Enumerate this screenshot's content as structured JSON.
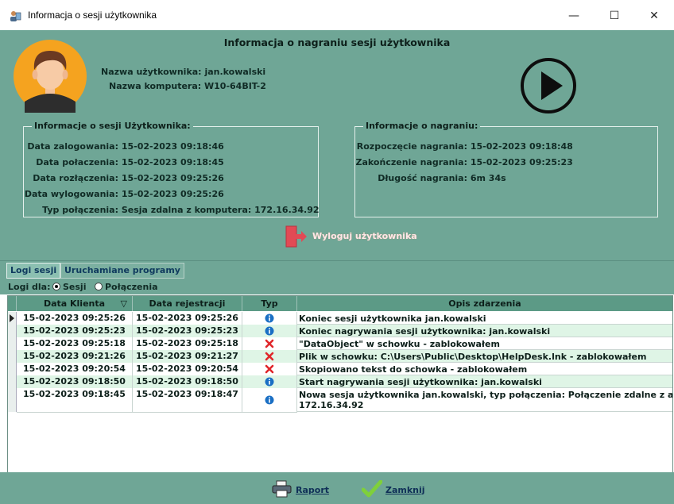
{
  "window": {
    "title": "Informacja o sesji użytkownika",
    "minimize_icon": "—",
    "maximize_icon": "☐",
    "close_icon": "✕"
  },
  "header": {
    "title": "Informacja o nagraniu sesji użytkownika"
  },
  "user": {
    "name_label": "Nazwa użytkownika:",
    "name_value": "jan.kowalski",
    "computer_label": "Nazwa komputera:",
    "computer_value": "W10-64BIT-2"
  },
  "session_info": {
    "legend": "Informacje o sesji Użytkownika:",
    "rows": [
      {
        "label": "Data zalogowania:",
        "value": "15-02-2023 09:18:46"
      },
      {
        "label": "Data połaczenia:",
        "value": "15-02-2023 09:18:45"
      },
      {
        "label": "Data rozłączenia:",
        "value": "15-02-2023 09:25:26"
      },
      {
        "label": "Data wylogowania:",
        "value": "15-02-2023 09:25:26"
      },
      {
        "label": "Typ połączenia:",
        "value": "Sesja zdalna z komputera: 172.16.34.92"
      }
    ]
  },
  "recording_info": {
    "legend": "Informacje o nagraniu:",
    "rows": [
      {
        "label": "Rozpoczęcie nagrania:",
        "value": "15-02-2023 09:18:48"
      },
      {
        "label": "Zakończenie nagrania:",
        "value": "15-02-2023 09:25:23"
      },
      {
        "label": "Długość nagrania:",
        "value": "6m 34s"
      }
    ]
  },
  "logout_button": {
    "label": "Wyloguj użytkownika"
  },
  "tabs": [
    {
      "label": "Logi sesji"
    },
    {
      "label": "Uruchamiane programy"
    }
  ],
  "log_filter": {
    "label": "Logi dla:",
    "options": [
      {
        "label": "Sesji",
        "selected": true
      },
      {
        "label": "Połączenia",
        "selected": false
      }
    ]
  },
  "grid": {
    "columns": [
      "Data Klienta",
      "Data rejestracji",
      "Typ",
      "Opis zdarzenia"
    ],
    "sort_icon": "▽",
    "rows": [
      {
        "client": "15-02-2023 09:25:26",
        "reg": "15-02-2023 09:25:26",
        "type": "info",
        "desc": "Koniec sesji użytkownika jan.kowalski",
        "desc2": "",
        "bg": "#ffffff"
      },
      {
        "client": "15-02-2023 09:25:23",
        "reg": "15-02-2023 09:25:23",
        "type": "info",
        "desc": "Koniec nagrywania sesji użytkownika: jan.kowalski",
        "desc2": "",
        "bg": "#dff5e6"
      },
      {
        "client": "15-02-2023 09:25:18",
        "reg": "15-02-2023 09:25:18",
        "type": "error",
        "desc": "\"DataObject\" w schowku - zablokowałem",
        "desc2": "",
        "bg": "#ffffff"
      },
      {
        "client": "15-02-2023 09:21:26",
        "reg": "15-02-2023 09:21:27",
        "type": "error",
        "desc": "Plik w schowku: C:\\Users\\Public\\Desktop\\HelpDesk.lnk - zablokowałem",
        "desc2": "",
        "bg": "#dff5e6"
      },
      {
        "client": "15-02-2023 09:20:54",
        "reg": "15-02-2023 09:20:54",
        "type": "error",
        "desc": "Skopiowano tekst do schowka - zablokowałem",
        "desc2": "",
        "bg": "#ffffff"
      },
      {
        "client": "15-02-2023 09:18:50",
        "reg": "15-02-2023 09:18:50",
        "type": "info",
        "desc": "Start nagrywania sesji użytkownika: jan.kowalski",
        "desc2": "",
        "bg": "#dff5e6"
      },
      {
        "client": "15-02-2023 09:18:45",
        "reg": "15-02-2023 09:18:47",
        "type": "info",
        "desc": "Nowa sesja użytkownika jan.kowalski, typ połączenia: Połączenie zdalne z adresu IP:",
        "desc2": "172.16.34.92",
        "bg": "#ffffff"
      }
    ]
  },
  "footer": {
    "report_label": "Raport",
    "close_label": "Zamknij"
  },
  "colors": {
    "panel": "#6fa696",
    "info": "#1a6fc4",
    "error": "#e0262a",
    "logout_icon": "#e24a55"
  },
  "icons": {
    "app": "user-session-icon",
    "play": "play-icon",
    "logout": "exit-door-icon",
    "report": "printer-icon",
    "close": "checkmark-icon"
  }
}
